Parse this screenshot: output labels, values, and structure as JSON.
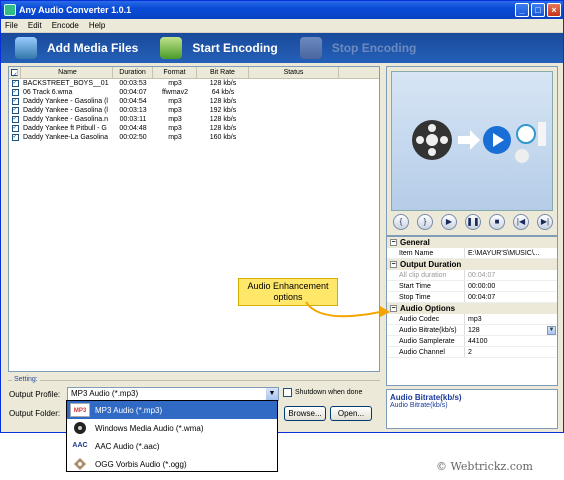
{
  "window": {
    "title": "Any Audio Converter 1.0.1"
  },
  "menu": [
    "File",
    "Edit",
    "Encode",
    "Help"
  ],
  "toolbar": {
    "add_label": "Add Media Files",
    "start_label": "Start Encoding",
    "stop_label": "Stop Encoding"
  },
  "file_list": {
    "headers": [
      "Name",
      "Duration",
      "Format",
      "Bit Rate",
      "Status"
    ],
    "rows": [
      {
        "name": "BACKSTREET_BOYS__01",
        "duration": "00:03:53",
        "format": "mp3",
        "bitrate": "128 kb/s",
        "status": ""
      },
      {
        "name": "06 Track 6.wma",
        "duration": "00:04:07",
        "format": "ffwmav2",
        "bitrate": "64 kb/s",
        "status": ""
      },
      {
        "name": "Daddy Yankee - Gasolina (l",
        "duration": "00:04:54",
        "format": "mp3",
        "bitrate": "128 kb/s",
        "status": ""
      },
      {
        "name": "Daddy Yankee - Gasolina (l",
        "duration": "00:03:13",
        "format": "mp3",
        "bitrate": "192 kb/s",
        "status": ""
      },
      {
        "name": "Daddy Yankee - Gasolina.n",
        "duration": "00:03:11",
        "format": "mp3",
        "bitrate": "128 kb/s",
        "status": ""
      },
      {
        "name": "Daddy Yankee ft Pitbull - G",
        "duration": "00:04:48",
        "format": "mp3",
        "bitrate": "128 kb/s",
        "status": ""
      },
      {
        "name": "Daddy Yankee-La Gasolina",
        "duration": "00:02:50",
        "format": "mp3",
        "bitrate": "160 kb/s",
        "status": ""
      }
    ]
  },
  "properties": {
    "general": {
      "title": "General",
      "item_name_label": "Item Name",
      "item_name_value": "E:\\MAYUR'S\\MUSIC\\..."
    },
    "output_duration": {
      "title": "Output Duration",
      "all_clip_label": "All clip duration",
      "all_clip_value": "00:04:07",
      "start_label": "Start Time",
      "start_value": "00:00:00",
      "stop_label": "Stop Time",
      "stop_value": "00:04:07"
    },
    "audio_options": {
      "title": "Audio Options",
      "codec_label": "Audio Codec",
      "codec_value": "mp3",
      "bitrate_label": "Audio Bitrate(kb/s)",
      "bitrate_value": "128",
      "samplerate_label": "Audio Samplerate",
      "samplerate_value": "44100",
      "channel_label": "Audio Channel",
      "channel_value": "2"
    }
  },
  "description": {
    "title": "Audio Bitrate(kb/s)",
    "text": "Audio Bitrate(kb/s)"
  },
  "settings": {
    "legend": "Setting:",
    "output_profile_label": "Output Profile:",
    "output_profile_value": "MP3 Audio (*.mp3)",
    "output_folder_label": "Output Folder:",
    "shutdown_label": "Shutdown when done",
    "browse_label": "Browse...",
    "open_label": "Open..."
  },
  "profile_options": [
    {
      "label": "MP3 Audio (*.mp3)",
      "icon": "mp3-icon",
      "badge": "MP3"
    },
    {
      "label": "Windows Media Audio (*.wma)",
      "icon": "wma-icon",
      "badge": ""
    },
    {
      "label": "AAC Audio (*.aac)",
      "icon": "aac-icon",
      "badge": "AAC"
    },
    {
      "label": "OGG Vorbis Audio (*.ogg)",
      "icon": "ogg-icon",
      "badge": ""
    }
  ],
  "annotation": {
    "line1": "Audio Enhancement",
    "line2": "options"
  },
  "watermark": "© Webtrickz.com"
}
